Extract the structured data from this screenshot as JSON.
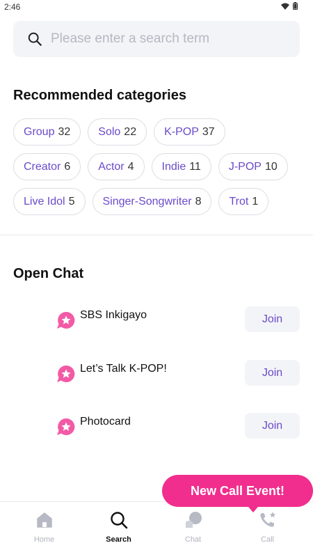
{
  "status": {
    "time": "2:46"
  },
  "search": {
    "placeholder": "Please enter a search term"
  },
  "categories": {
    "title": "Recommended categories",
    "rows": [
      [
        {
          "name": "Group",
          "count": "32"
        },
        {
          "name": "Solo",
          "count": "22"
        },
        {
          "name": "K-POP",
          "count": "37"
        }
      ],
      [
        {
          "name": "Creator",
          "count": "6"
        },
        {
          "name": "Actor",
          "count": "4"
        },
        {
          "name": "Indie",
          "count": "11"
        },
        {
          "name": "J-POP",
          "count": "10"
        }
      ],
      [
        {
          "name": "Live Idol",
          "count": "5"
        },
        {
          "name": "Singer-Songwriter",
          "count": "8"
        },
        {
          "name": "Trot",
          "count": "1"
        }
      ]
    ]
  },
  "open_chat": {
    "title": "Open Chat",
    "join_label": "Join",
    "items": [
      {
        "name": "SBS Inkigayo"
      },
      {
        "name": "Let’s Talk K-POP!"
      },
      {
        "name": "Photocard"
      }
    ]
  },
  "event": {
    "label": "New Call Event!"
  },
  "nav": {
    "items": [
      {
        "label": "Home",
        "icon": "home-icon"
      },
      {
        "label": "Search",
        "icon": "search-icon"
      },
      {
        "label": "Chat",
        "icon": "chat-icon"
      },
      {
        "label": "Call",
        "icon": "call-icon"
      }
    ],
    "active": "Search"
  },
  "colors": {
    "accent": "#6a4ac9",
    "event_pink": "#f12d8d",
    "chat_icon_pink": "#f25aa6",
    "input_bg": "#f3f4f7"
  }
}
